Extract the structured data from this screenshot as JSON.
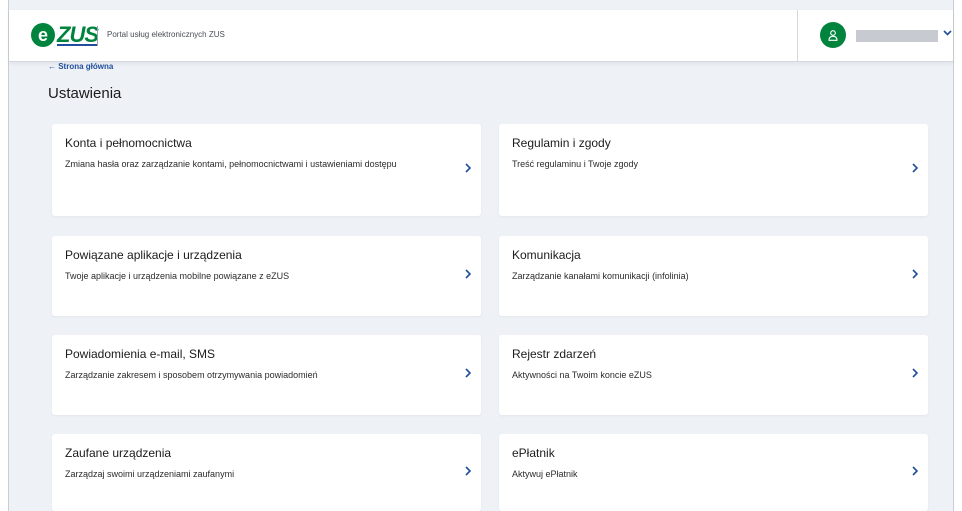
{
  "header": {
    "logo_e": "e",
    "logo_zus": "ZUS",
    "portal_title": "Portal usług elektronicznych ZUS",
    "chevron": "⌄"
  },
  "nav": {
    "back_link": "← Strona główna"
  },
  "page": {
    "title": "Ustawienia"
  },
  "cards": [
    {
      "title": "Konta i pełnomocnictwa",
      "desc": "Zmiana hasła oraz zarządzanie kontami, pełnomocnictwami i ustawieniami dostępu"
    },
    {
      "title": "Regulamin i zgody",
      "desc": "Treść regulaminu i Twoje zgody"
    },
    {
      "title": "Powiązane aplikacje i urządzenia",
      "desc": "Twoje aplikacje i urządzenia mobilne powiązane z eZUS"
    },
    {
      "title": "Komunikacja",
      "desc": "Zarządzanie kanałami komunikacji (infolinia)"
    },
    {
      "title": "Powiadomienia e-mail, SMS",
      "desc": "Zarządzanie zakresem i sposobem otrzymywania powiadomień"
    },
    {
      "title": "Rejestr zdarzeń",
      "desc": "Aktywności na Twoim koncie eZUS"
    },
    {
      "title": "Zaufane urządzenia",
      "desc": "Zarządzaj swoimi urządzeniami zaufanymi"
    },
    {
      "title": "ePłatnik",
      "desc": "Aktywuj ePłatnik"
    }
  ],
  "icons": {
    "card_arrow": "›",
    "avatar": "user-icon"
  },
  "colors": {
    "brand_green": "#00843d",
    "link_blue": "#1f4e9c",
    "background": "#eef1f6"
  }
}
